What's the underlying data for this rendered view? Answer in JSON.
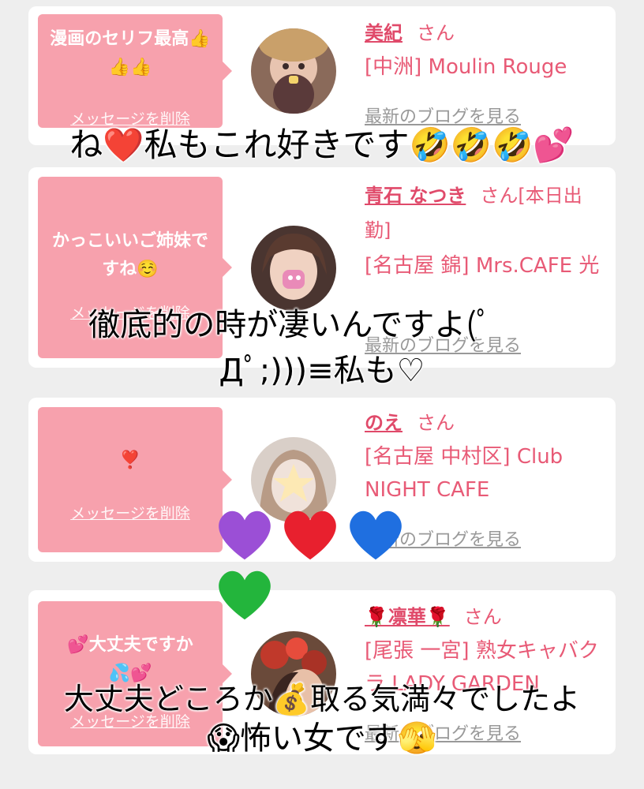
{
  "cards": [
    {
      "message": "漫画のセリフ最高👍👍👍",
      "delete_label": "メッセージを削除",
      "name": "美紀",
      "honorific": "さん",
      "shop": "[中洲] Moulin Rouge",
      "blog_link": "最新のブログを見る"
    },
    {
      "message": "かっこいいご姉妹ですね☺️",
      "delete_label": "メッセージを削除",
      "name": "青石 なつき",
      "honorific": "さん[本日出勤]",
      "shop": "[名古屋 錦] Mrs.CAFE 光",
      "blog_link": "最新のブログを見る"
    },
    {
      "message": "❣️",
      "delete_label": "メッセージを削除",
      "name": "のえ",
      "honorific": "さん",
      "shop": "[名古屋 中村区] Club NIGHT CAFE",
      "blog_link": "最新のブログを見る"
    },
    {
      "message": "💕大丈夫ですか💦💕",
      "delete_label": "メッセージを削除",
      "name": "🌹凛華🌹",
      "honorific": "さん",
      "shop": "[尾張 一宮] 熟女キャバクラ LADY GARDEN",
      "blog_link": "最新のブログを見る"
    }
  ],
  "overlays": {
    "line1": "ね❤️私もこれ好きです🤣🤣🤣💕",
    "line2a": "徹底的の時が凄いんですよ(ﾟ",
    "line2b": "Дﾟ;)))≡私も♡",
    "line3a": "大丈夫どころか💰取る気満々でしたよ",
    "line3b": "😱怖い女です🫣"
  },
  "colors": {
    "accent": "#e85a76",
    "bubble": "#f7a1ad",
    "card": "#ffffff",
    "background": "#eeeeee"
  },
  "hearts": [
    "purple-heart",
    "red-heart",
    "blue-heart",
    "green-heart"
  ]
}
